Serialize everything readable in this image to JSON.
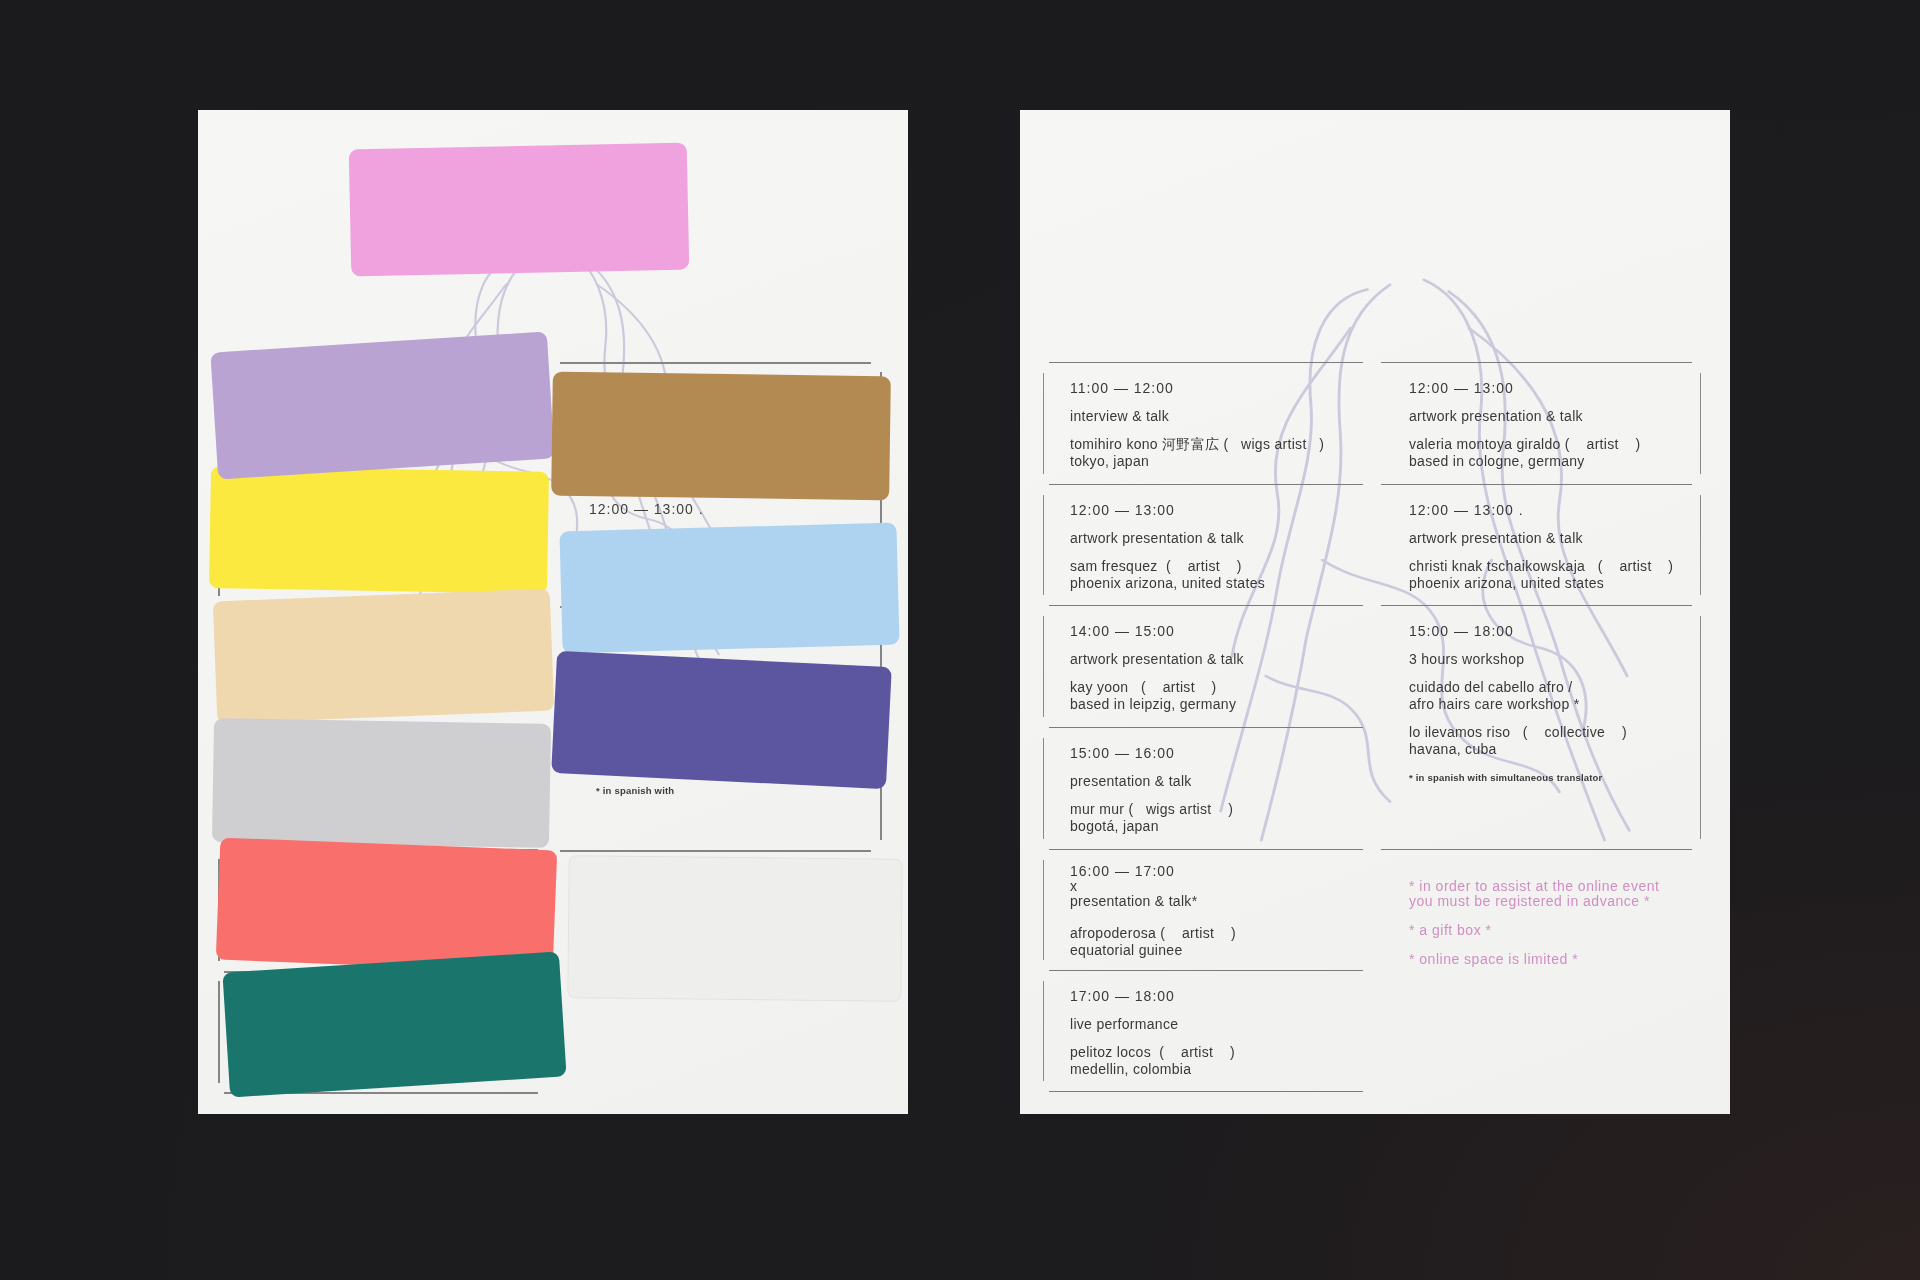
{
  "left_poster": {
    "stickers": [
      {
        "color": "#f0a2de"
      },
      {
        "color": "#b8a3d3"
      },
      {
        "color": "#fbe93f"
      },
      {
        "color": "#efd8ae"
      },
      {
        "color": "#cfcfd1"
      },
      {
        "color": "#f96f6c"
      },
      {
        "color": "#1a766d"
      },
      {
        "color": "#b38b52"
      },
      {
        "color": "#aed3f1"
      },
      {
        "color": "#5c55a0"
      }
    ],
    "visible_time": "12:00 — 13:00 .",
    "visible_footnote": "* in spanish with"
  },
  "right_poster": {
    "columns": [
      {
        "entries": [
          {
            "time": "11:00 — 12:00",
            "activity": "interview & talk",
            "person": "tomihiro kono 河野富広 (   wigs artist   )",
            "place": "tokyo, japan"
          },
          {
            "time": "12:00 — 13:00",
            "activity": "artwork presentation & talk",
            "person": "sam fresquez  (    artist    )",
            "place": "phoenix arizona, united states"
          },
          {
            "time": "14:00 — 15:00",
            "activity": "artwork presentation & talk",
            "person": "kay yoon   (    artist    )",
            "place": "based in leipzig, germany"
          },
          {
            "time": "15:00 — 16:00",
            "activity": "presentation & talk",
            "person": "mur mur (   wigs artist    )",
            "place": "bogotá, japan"
          },
          {
            "time": "16:00 — 17:00",
            "marker": "x",
            "activity": "presentation & talk*",
            "person": "afropoderosa (    artist    )",
            "place": "equatorial guinee"
          },
          {
            "time": "17:00 — 18:00",
            "activity": "live performance",
            "person": "pelitoz locos  (    artist    )",
            "place": "medellin, colombia"
          }
        ]
      },
      {
        "entries": [
          {
            "time": "12:00 — 13:00",
            "activity": "artwork presentation & talk",
            "person": "valeria montoya giraldo (    artist    )",
            "place": "based in cologne, germany"
          },
          {
            "time": "12:00 — 13:00 .",
            "activity": "artwork presentation & talk",
            "person": "christi knak tschaikowskaja   (    artist    )",
            "place": "phoenix arizona, united states"
          },
          {
            "time": "15:00 — 18:00",
            "activity": "3 hours workshop",
            "title": "cuidado del cabello afro /\nafro hairs care workshop *",
            "person": "lo ilevamos riso   (    collective    )",
            "place": "havana, cuba",
            "footnote": "* in spanish with simultaneous translator"
          }
        ],
        "notes": [
          "* in order to assist at the online event\nyou must be registered in advance *",
          "* a gift box *",
          "* online space is limited *"
        ]
      }
    ]
  }
}
